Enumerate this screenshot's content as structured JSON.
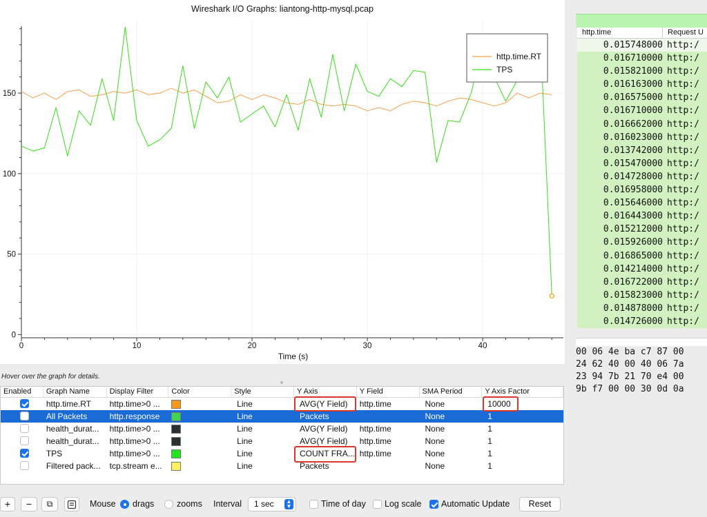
{
  "title": "Wireshark I/O Graphs: liantong-http-mysql.pcap",
  "chart_data": {
    "type": "line",
    "xlabel": "Time (s)",
    "ylabel": "",
    "xlim": [
      0,
      47
    ],
    "ylim": [
      -2,
      195
    ],
    "x_ticks": [
      0,
      10,
      20,
      30,
      40
    ],
    "y_ticks": [
      0,
      50,
      100,
      150
    ],
    "grid": true,
    "legend_position": "top-right",
    "series": [
      {
        "name": "http.time.RT",
        "color": "#f5a04b",
        "x": [
          0,
          1,
          2,
          3,
          4,
          5,
          6,
          7,
          8,
          9,
          10,
          11,
          12,
          13,
          14,
          15,
          16,
          17,
          18,
          19,
          20,
          21,
          22,
          23,
          24,
          25,
          26,
          27,
          28,
          29,
          30,
          31,
          32,
          33,
          34,
          35,
          36,
          37,
          38,
          39,
          40,
          41,
          42,
          43,
          44,
          45,
          46
        ],
        "values": [
          151,
          147,
          150,
          146,
          151,
          152,
          148,
          149,
          151,
          150,
          152,
          149,
          150,
          153,
          150,
          152,
          148,
          144,
          145,
          149,
          146,
          149,
          147,
          144,
          143,
          146,
          143,
          142,
          143,
          142,
          139,
          141,
          139,
          143,
          145,
          144,
          142,
          145,
          147,
          146,
          144,
          142,
          144,
          150,
          147,
          150,
          149
        ]
      },
      {
        "name": "TPS",
        "color": "#33e014",
        "x": [
          0,
          1,
          2,
          3,
          4,
          5,
          6,
          7,
          8,
          9,
          10,
          11,
          12,
          13,
          14,
          15,
          16,
          17,
          18,
          19,
          20,
          21,
          22,
          23,
          24,
          25,
          26,
          27,
          28,
          29,
          30,
          31,
          32,
          33,
          34,
          35,
          36,
          37,
          38,
          39,
          40,
          41,
          42,
          43,
          44,
          45,
          46
        ],
        "values": [
          117,
          114,
          116,
          141,
          111,
          139,
          130,
          159,
          133,
          191,
          133,
          117,
          121,
          128,
          167,
          128,
          157,
          147,
          160,
          132,
          137,
          142,
          129,
          149,
          127,
          159,
          135,
          174,
          139,
          168,
          151,
          148,
          159,
          154,
          164,
          163,
          107,
          133,
          132,
          150,
          180,
          160,
          145,
          158,
          162,
          187,
          24
        ]
      }
    ]
  },
  "legend": [
    "http.time.RT",
    "TPS"
  ],
  "hint": "Hover over the graph for details.",
  "table": {
    "headers": [
      "Enabled",
      "Graph Name",
      "Display Filter",
      "Color",
      "Style",
      "Y Axis",
      "Y Field",
      "SMA Period",
      "Y Axis Factor"
    ],
    "rows": [
      {
        "enabled": true,
        "name": "http.time.RT",
        "filter": "http.time>0 ...",
        "color": "#f79a1b",
        "style": "Line",
        "yaxis": "AVG(Y Field)",
        "yfield": "http.time",
        "sma": "None",
        "factor": "10000"
      },
      {
        "enabled": false,
        "name": "All Packets",
        "filter": "http.response",
        "color": "#3fd64f",
        "style": "Line",
        "yaxis": "Packets",
        "yfield": "",
        "sma": "None",
        "factor": "1"
      },
      {
        "enabled": false,
        "name": "health_durat...",
        "filter": "http.time>0 ...",
        "color": "#2c2f33",
        "style": "Line",
        "yaxis": "AVG(Y Field)",
        "yfield": "http.time",
        "sma": "None",
        "factor": "1"
      },
      {
        "enabled": false,
        "name": "health_durat...",
        "filter": "http.time>0 ...",
        "color": "#2c2f33",
        "style": "Line",
        "yaxis": "AVG(Y Field)",
        "yfield": "http.time",
        "sma": "None",
        "factor": "1"
      },
      {
        "enabled": true,
        "name": "TPS",
        "filter": "http.time>0 ...",
        "color": "#1ee61e",
        "style": "Line",
        "yaxis": "COUNT FRA...",
        "yfield": "http.time",
        "sma": "None",
        "factor": "1"
      },
      {
        "enabled": false,
        "name": "Filtered pack...",
        "filter": "tcp.stream e...",
        "color": "#fff060",
        "style": "Line",
        "yaxis": "Packets",
        "yfield": "",
        "sma": "None",
        "factor": "1"
      }
    ]
  },
  "toolbar": {
    "add": "+",
    "remove": "−",
    "copy": "⧉",
    "mouse_label": "Mouse",
    "drags_label": "drags",
    "zooms_label": "zooms",
    "interval_label": "Interval",
    "interval_value": "1 sec",
    "time_of_day": "Time of day",
    "log_scale": "Log scale",
    "auto_update": "Automatic Update",
    "reset": "Reset"
  },
  "packets": {
    "col_time": "http.time",
    "col_req": "Request U",
    "rows": [
      {
        "t": "0.015748000",
        "u": "http:/"
      },
      {
        "t": "0.016710000",
        "u": "http:/"
      },
      {
        "t": "0.015821000",
        "u": "http:/"
      },
      {
        "t": "0.016163000",
        "u": "http:/"
      },
      {
        "t": "0.016575000",
        "u": "http:/"
      },
      {
        "t": "0.016710000",
        "u": "http:/"
      },
      {
        "t": "0.016662000",
        "u": "http:/"
      },
      {
        "t": "0.016023000",
        "u": "http:/"
      },
      {
        "t": "0.013742000",
        "u": "http:/"
      },
      {
        "t": "0.015470000",
        "u": "http:/"
      },
      {
        "t": "0.014728000",
        "u": "http:/"
      },
      {
        "t": "0.016958000",
        "u": "http:/"
      },
      {
        "t": "0.015646000",
        "u": "http:/"
      },
      {
        "t": "0.016443000",
        "u": "http:/"
      },
      {
        "t": "0.015212000",
        "u": "http:/"
      },
      {
        "t": "0.015926000",
        "u": "http:/"
      },
      {
        "t": "0.016865000",
        "u": "http:/"
      },
      {
        "t": "0.014214000",
        "u": "http:/"
      },
      {
        "t": "0.016722000",
        "u": "http:/"
      },
      {
        "t": "0.015823000",
        "u": "http:/"
      },
      {
        "t": "0.014878000",
        "u": "http:/"
      },
      {
        "t": "0.014726000",
        "u": "http:/"
      }
    ]
  },
  "hex": [
    "00 06 4e ba  c7 87 00",
    "24 62 40 00  40 06 7a",
    "23 94 7b 21  70 e4 00",
    "9b f7 00 00  30 0d 0a"
  ]
}
